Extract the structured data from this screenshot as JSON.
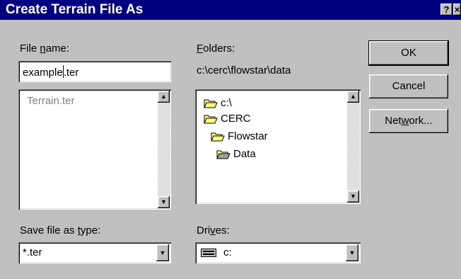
{
  "window": {
    "title": "Create Terrain File As",
    "help_glyph": "?",
    "close_glyph": "×"
  },
  "file_name": {
    "label_pre": "File ",
    "label_accel": "n",
    "label_post": "ame:",
    "value_before_caret": "example",
    "value_after_caret": ".ter"
  },
  "file_list": {
    "items": [
      "Terrain.ter"
    ]
  },
  "folders": {
    "label_accel": "F",
    "label_post": "olders:",
    "current_path": "c:\\cerc\\flowstar\\data",
    "tree": [
      {
        "label": "c:\\",
        "icon": "open-folder-icon"
      },
      {
        "label": "CERC",
        "icon": "open-folder-icon"
      },
      {
        "label": "Flowstar",
        "icon": "open-folder-icon"
      },
      {
        "label": "Data",
        "icon": "open-folder-icon"
      }
    ]
  },
  "save_type": {
    "label_pre": "Save file as ",
    "label_accel": "t",
    "label_post": "ype:",
    "value": "*.ter"
  },
  "drives": {
    "label_pre": "Dri",
    "label_accel": "v",
    "label_post": "es:",
    "value": "c:",
    "icon": "drive-icon"
  },
  "buttons": {
    "ok": "OK",
    "cancel": "Cancel",
    "network_pre": "Net",
    "network_accel": "w",
    "network_post": "ork..."
  },
  "icons": {
    "scroll_up": "▲",
    "scroll_down": "▼",
    "dropdown": "▼"
  },
  "colors": {
    "titlebar": "#000080",
    "face": "#c0c0c0",
    "folder": "#ffff80"
  }
}
